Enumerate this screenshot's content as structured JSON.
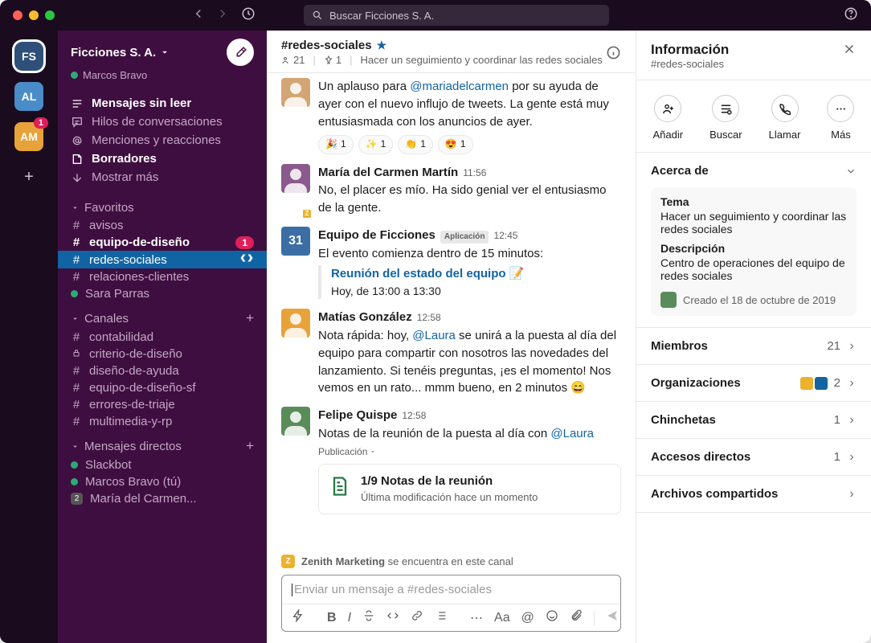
{
  "titlebar": {
    "search_placeholder": "Buscar Ficciones S. A."
  },
  "workspaces": [
    {
      "initials": "FS",
      "class": "fs"
    },
    {
      "initials": "AL",
      "class": "al"
    },
    {
      "initials": "AM",
      "class": "am",
      "badge": "1"
    }
  ],
  "sidebar": {
    "title": "Ficciones S. A.",
    "user": "Marcos Bravo",
    "nav": {
      "unread": "Mensajes sin leer",
      "threads": "Hilos de conversaciones",
      "mentions": "Menciones y reacciones",
      "drafts": "Borradores",
      "more": "Mostrar más"
    },
    "sections": {
      "starred": "Favoritos",
      "channels": "Canales",
      "dms": "Mensajes directos"
    },
    "starred": [
      {
        "prefix": "#",
        "name": "avisos"
      },
      {
        "prefix": "#",
        "name": "equipo-de-diseño",
        "bold": true,
        "badge": "1"
      },
      {
        "prefix": "#",
        "name": "redes-sociales",
        "active": true,
        "arrows": true
      },
      {
        "prefix": "#",
        "name": "relaciones-clientes"
      },
      {
        "prefix": "dot",
        "name": "Sara Parras"
      }
    ],
    "channels": [
      {
        "prefix": "#",
        "name": "contabilidad"
      },
      {
        "prefix": "lock",
        "name": "criterio-de-diseño"
      },
      {
        "prefix": "#",
        "name": "diseño-de-ayuda"
      },
      {
        "prefix": "#",
        "name": "equipo-de-diseño-sf"
      },
      {
        "prefix": "#",
        "name": "errores-de-triaje"
      },
      {
        "prefix": "#",
        "name": "multimedia-y-rp"
      }
    ],
    "dms": [
      {
        "prefix": "dot",
        "name": "Slackbot"
      },
      {
        "prefix": "dot",
        "name": "Marcos Bravo (tú)"
      },
      {
        "prefix": "sq",
        "name": "María del Carmen..."
      }
    ]
  },
  "channel": {
    "name": "#redes-sociales",
    "members": "21",
    "pins": "1",
    "topic": "Hacer un seguimiento y coordinar las redes sociales",
    "zenith": {
      "name": "Zenith Marketing",
      "suffix": "se encuentra en este canal"
    }
  },
  "messages": [
    {
      "text_pre": "Un aplauso para ",
      "mention": "@mariadelcarmen",
      "text_post": " por su ayuda de ayer con el nuevo influjo de tweets. La gente está muy entusiasmada con los anuncios de ayer.",
      "reactions": [
        {
          "emoji": "🎉",
          "count": "1"
        },
        {
          "emoji": "✨",
          "count": "1"
        },
        {
          "emoji": "👏",
          "count": "1"
        },
        {
          "emoji": "😍",
          "count": "1"
        }
      ]
    },
    {
      "name": "María del Carmen Martín",
      "time": "11:56",
      "text": "No, el placer es mío. Ha sido genial ver el entusiasmo de la gente."
    },
    {
      "name": "Equipo de Ficciones",
      "app_badge": "Aplicación",
      "time": "12:45",
      "text": "El evento comienza dentro de 15 minutos:",
      "event": {
        "title": "Reunión del estado del equipo",
        "emoji": "📝",
        "time": "Hoy, de 13:00 a 13:30"
      }
    },
    {
      "name": "Matías González",
      "time": "12:58",
      "text_pre": "Nota rápida: hoy, ",
      "mention": "@Laura",
      "text_post": " se unirá a la puesta al día del equipo para compartir con nosotros las novedades del lanzamiento. Si tenéis preguntas, ¡es el momento! Nos vemos en un rato... mmm bueno, en 2 minutos 😄"
    },
    {
      "name": "Felipe Quispe",
      "time": "12:58",
      "text_pre": "Notas de la reunión de la puesta al día con ",
      "mention": "@Laura",
      "pub": "Publicación",
      "post": {
        "title": "1/9 Notas de la reunión",
        "sub": "Última modificación hace un momento"
      }
    }
  ],
  "composer": {
    "placeholder": "Enviar un mensaje a #redes-sociales",
    "aa": "Aa"
  },
  "details": {
    "title": "Información",
    "sub": "#redes-sociales",
    "actions": {
      "add": "Añadir",
      "find": "Buscar",
      "call": "Llamar",
      "more": "Más"
    },
    "about": {
      "heading": "Acerca de",
      "topic_label": "Tema",
      "topic": "Hacer un seguimiento y coordinar las redes sociales",
      "desc_label": "Descripción",
      "desc": "Centro de operaciones del equipo de redes sociales",
      "created": "Creado el 18 de octubre de 2019"
    },
    "rows": {
      "members": {
        "label": "Miembros",
        "count": "21"
      },
      "orgs": {
        "label": "Organizaciones",
        "count": "2"
      },
      "pins": {
        "label": "Chinchetas",
        "count": "1"
      },
      "shortcuts": {
        "label": "Accesos directos",
        "count": "1"
      },
      "files": {
        "label": "Archivos compartidos"
      }
    }
  }
}
